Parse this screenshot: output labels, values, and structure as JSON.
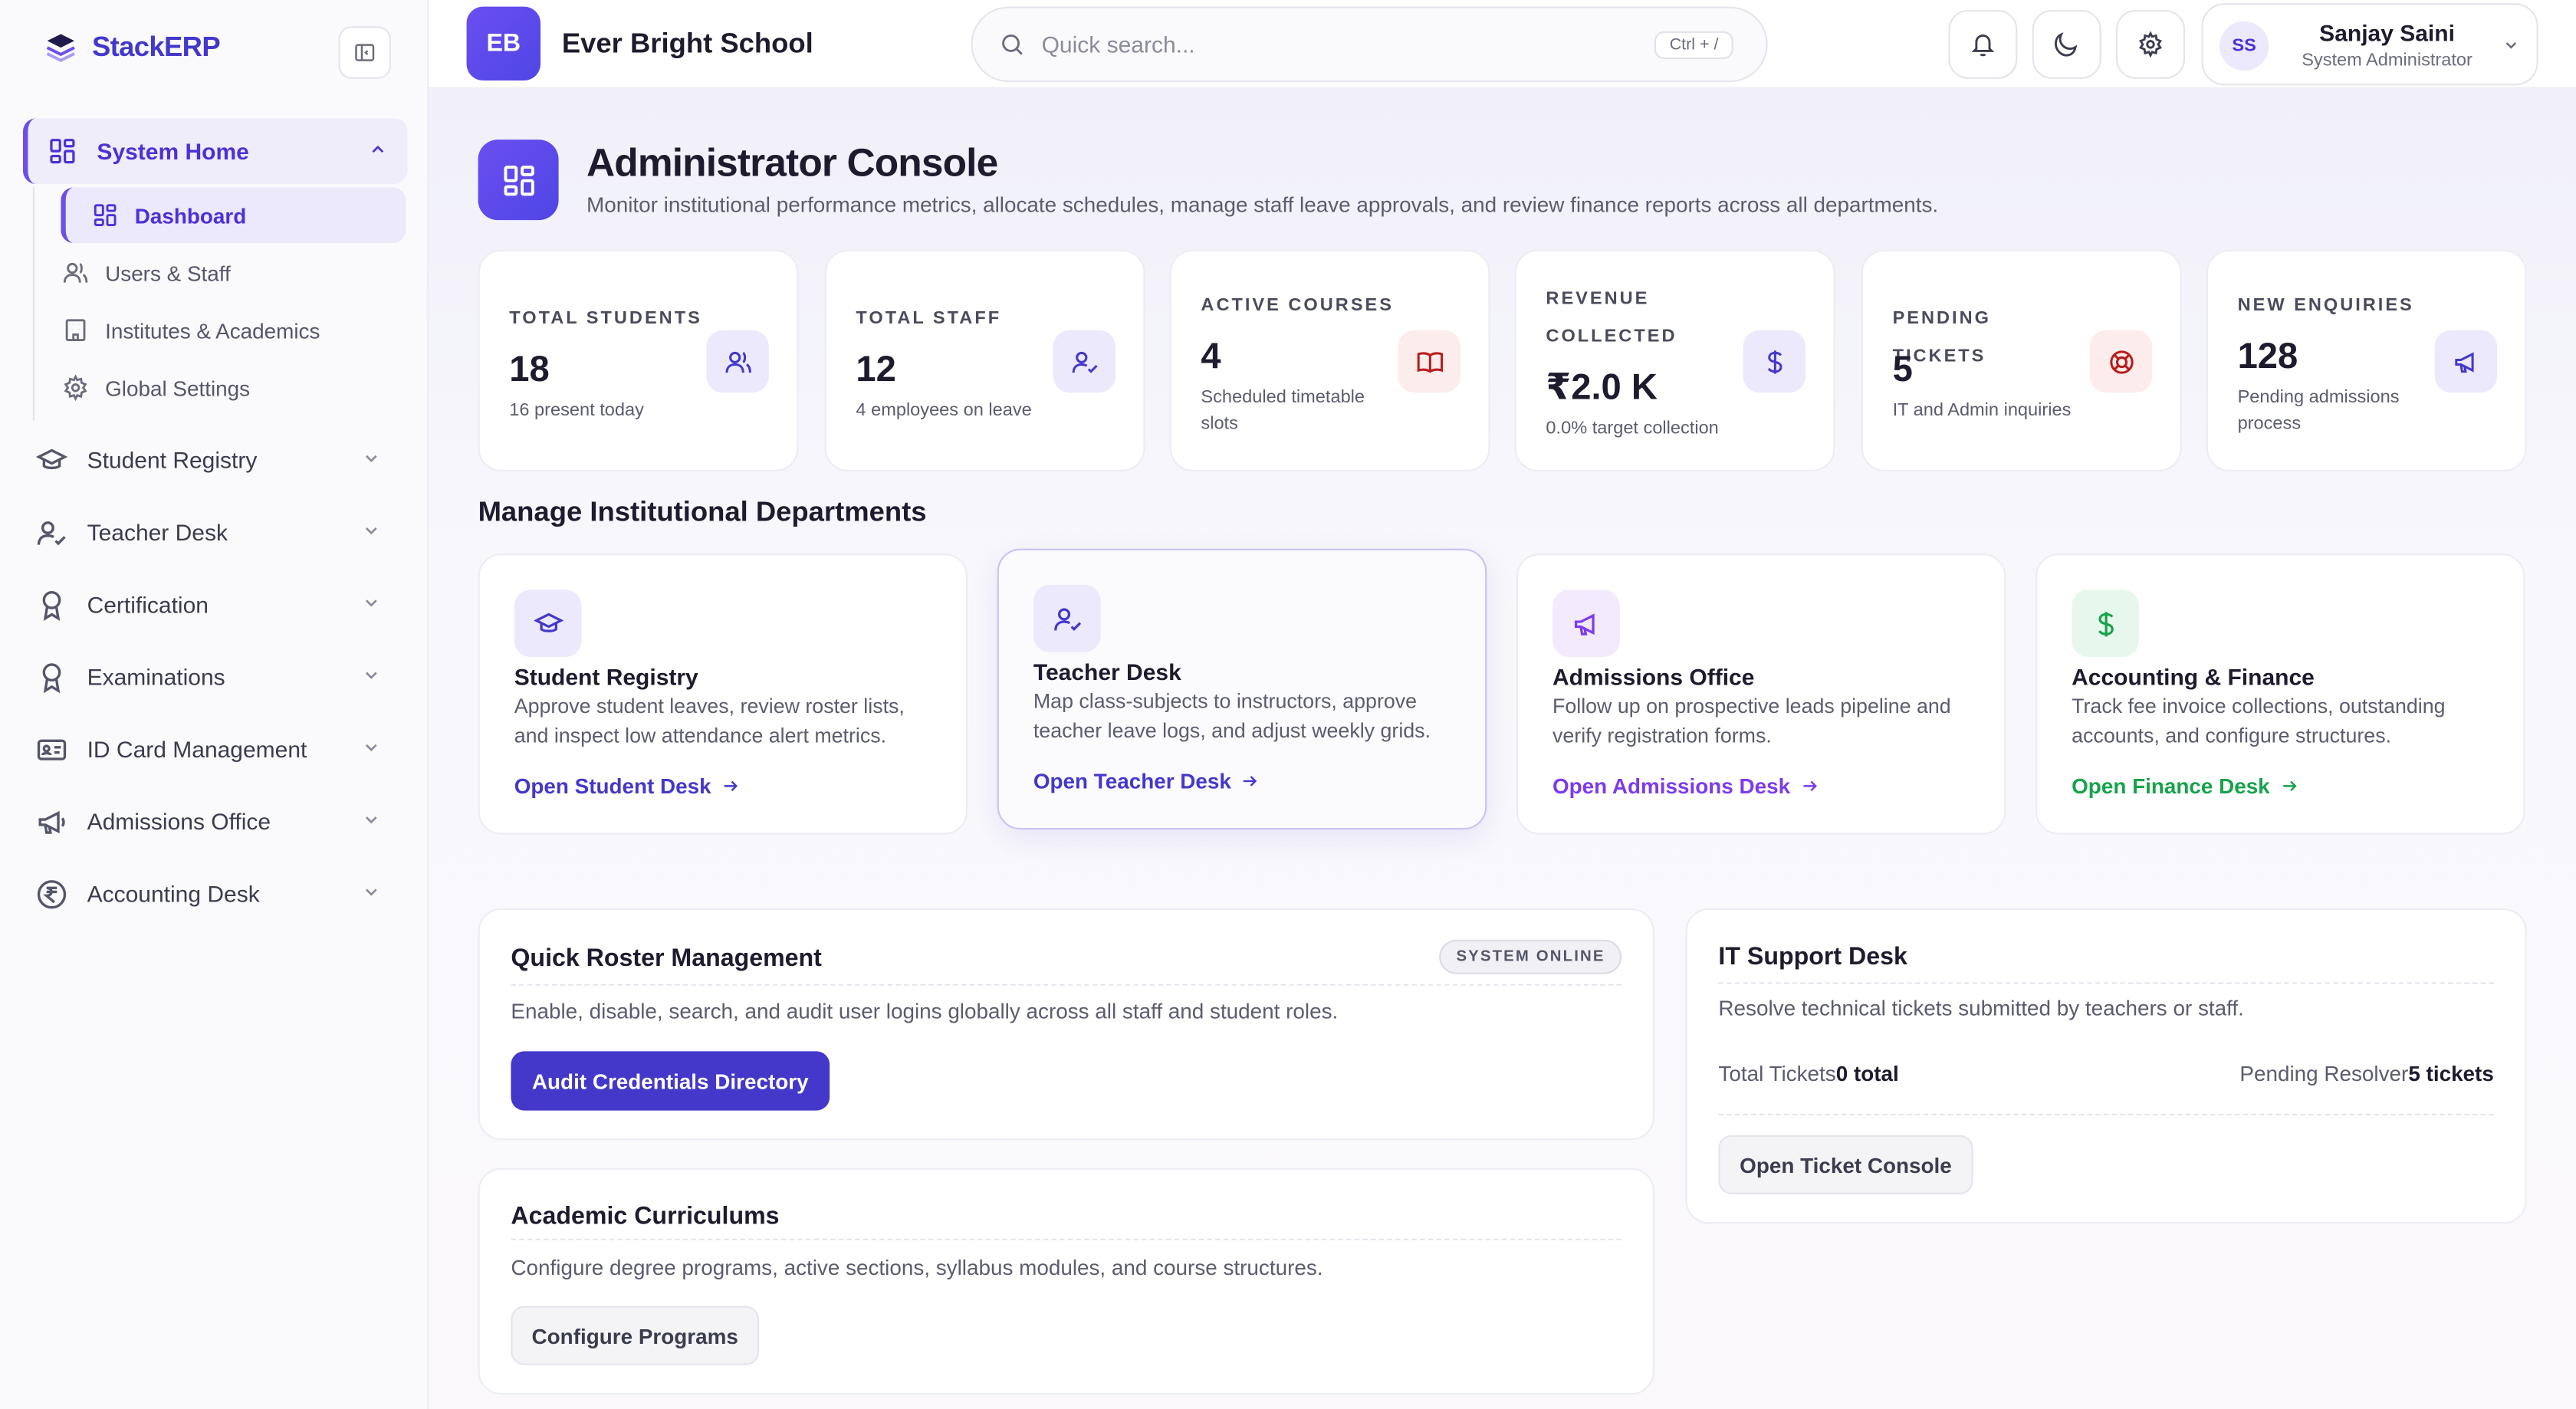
{
  "brand": {
    "name": "StackERP"
  },
  "sidebar": {
    "group_open": {
      "label": "System Home"
    },
    "sub_items": [
      {
        "label": "Dashboard",
        "icon": "dashboard-icon"
      },
      {
        "label": "Users & Staff",
        "icon": "users-icon"
      },
      {
        "label": "Institutes & Academics",
        "icon": "building-icon"
      },
      {
        "label": "Global Settings",
        "icon": "gear-icon"
      }
    ],
    "items": [
      {
        "label": "Student Registry",
        "icon": "graduation-cap-icon"
      },
      {
        "label": "Teacher Desk",
        "icon": "user-check-icon"
      },
      {
        "label": "Certification",
        "icon": "award-icon"
      },
      {
        "label": "Examinations",
        "icon": "award-icon"
      },
      {
        "label": "ID Card Management",
        "icon": "id-card-icon"
      },
      {
        "label": "Admissions Office",
        "icon": "megaphone-icon"
      },
      {
        "label": "Accounting Desk",
        "icon": "rupee-icon"
      }
    ]
  },
  "header": {
    "school_initials": "EB",
    "school_name": "Ever Bright School",
    "search_placeholder": "Quick search...",
    "search_shortcut": "Ctrl + /",
    "user": {
      "initials": "SS",
      "name": "Sanjay Saini",
      "role": "System Administrator"
    }
  },
  "console": {
    "title": "Administrator Console",
    "subtitle": "Monitor institutional performance metrics, allocate schedules, manage staff leave approvals, and review finance reports across all departments."
  },
  "stats": [
    {
      "label": "TOTAL STUDENTS",
      "value": "18",
      "note": "16 present today",
      "icon": "users-icon"
    },
    {
      "label": "TOTAL STAFF",
      "value": "12",
      "note": "4 employees on leave",
      "icon": "user-check-icon"
    },
    {
      "label": "ACTIVE COURSES",
      "value": "4",
      "note": "Scheduled timetable slots",
      "icon": "book-icon"
    },
    {
      "label": "REVENUE COLLECTED",
      "value": "₹2.0 K",
      "note": "0.0% target collection",
      "icon": "dollar-icon"
    },
    {
      "label": "PENDING TICKETS",
      "value": "5",
      "note": "IT and Admin inquiries",
      "icon": "lifebuoy-icon"
    },
    {
      "label": "NEW ENQUIRIES",
      "value": "128",
      "note": "Pending admissions process",
      "icon": "megaphone-icon"
    }
  ],
  "departments_title": "Manage Institutional Departments",
  "departments": [
    {
      "title": "Student Registry",
      "desc": "Approve student leaves, review roster lists, and inspect low attendance alert metrics.",
      "link": "Open Student Desk",
      "icon": "graduation-cap-icon",
      "color": "#4338ca"
    },
    {
      "title": "Teacher Desk",
      "desc": "Map class-subjects to instructors, approve teacher leave logs, and adjust weekly grids.",
      "link": "Open Teacher Desk",
      "icon": "user-check-icon",
      "color": "#4338ca"
    },
    {
      "title": "Admissions Office",
      "desc": "Follow up on prospective leads pipeline and verify registration forms.",
      "link": "Open Admissions Desk",
      "icon": "megaphone-icon",
      "color": "#7c3aed"
    },
    {
      "title": "Accounting & Finance",
      "desc": "Track fee invoice collections, outstanding accounts, and configure structures.",
      "link": "Open Finance Desk",
      "icon": "dollar-icon",
      "color": "#16a34a"
    }
  ],
  "roster": {
    "title": "Quick Roster Management",
    "badge": "SYSTEM ONLINE",
    "desc": "Enable, disable, search, and audit user logins globally across all staff and student roles.",
    "button": "Audit Credentials Directory"
  },
  "curriculums": {
    "title": "Academic Curriculums",
    "desc": "Configure degree programs, active sections, syllabus modules, and course structures.",
    "button": "Configure Programs"
  },
  "support": {
    "title": "IT Support Desk",
    "desc": "Resolve technical tickets submitted by teachers or staff.",
    "total_label": "Total Tickets",
    "total_value": "0 total",
    "pending_label": "Pending Resolver",
    "pending_value": "5 tickets",
    "button": "Open Ticket Console"
  }
}
